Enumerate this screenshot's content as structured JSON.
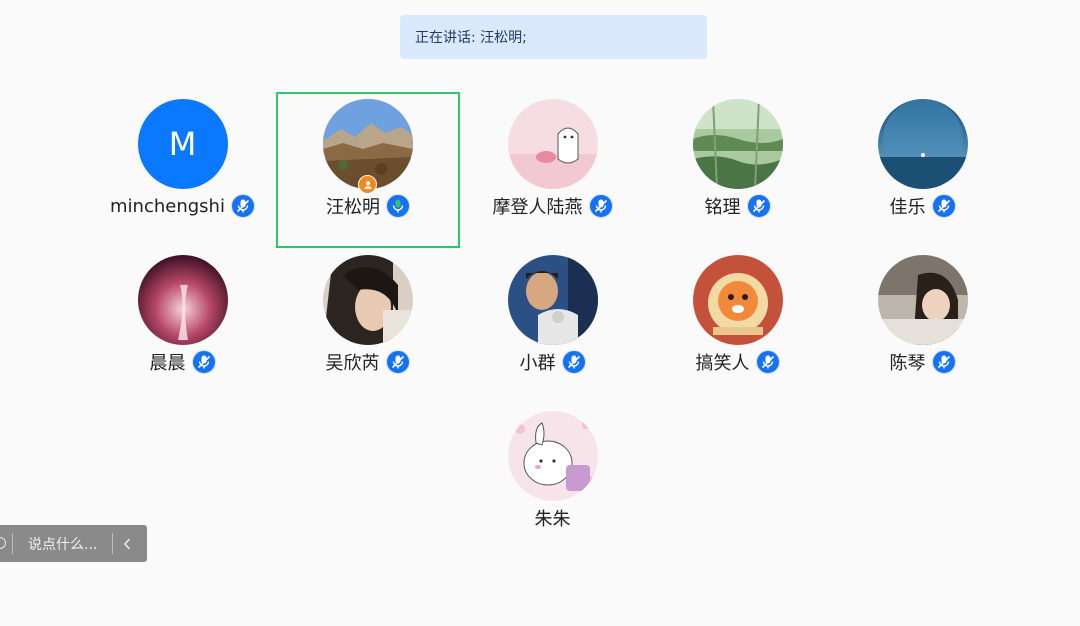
{
  "banner": {
    "label": "正在讲话:",
    "speaker": "汪松明;"
  },
  "participants": [
    {
      "name": "minchengshi",
      "avatar": "letter-avatar",
      "avatar_letter": "M",
      "mic": "muted-mic-icon",
      "speaking": false
    },
    {
      "name": "汪松明",
      "avatar": "mountain-photo-avatar",
      "mic": "active-mic-icon",
      "speaking": true,
      "host": true
    },
    {
      "name": "摩登人陆燕",
      "avatar": "cartoon-penguin-avatar",
      "mic": "muted-mic-icon",
      "speaking": false
    },
    {
      "name": "铭理",
      "avatar": "green-forest-avatar",
      "mic": "muted-mic-icon",
      "speaking": false
    },
    {
      "name": "佳乐",
      "avatar": "planet-sky-avatar",
      "mic": "muted-mic-icon",
      "speaking": false
    },
    {
      "name": "晨晨",
      "avatar": "pink-glow-avatar",
      "mic": "muted-mic-icon",
      "speaking": false
    },
    {
      "name": "吴欣芮",
      "avatar": "portrait-photo-avatar",
      "mic": "muted-mic-icon",
      "speaking": false
    },
    {
      "name": "小群",
      "avatar": "man-with-dog-avatar",
      "mic": "muted-mic-icon",
      "speaking": false
    },
    {
      "name": "搞笑人",
      "avatar": "tiger-cartoon-avatar",
      "mic": "muted-mic-icon",
      "speaking": false
    },
    {
      "name": "陈琴",
      "avatar": "girl-photo-avatar",
      "mic": "muted-mic-icon",
      "speaking": false
    },
    {
      "name": "朱朱",
      "avatar": "bunny-cartoon-avatar",
      "mic": "",
      "speaking": false
    }
  ],
  "chat": {
    "placeholder": "说点什么...",
    "collapse_icon": "chevron-left-icon"
  },
  "colors": {
    "background": "#fafafa",
    "banner_bg": "#dbe9fc",
    "active_border": "#2fc76b",
    "mic_muted": "#1672f3",
    "mic_active": "#33c26a",
    "host_badge": "#f08a1c",
    "letter_avatar": "#0a78ff"
  }
}
